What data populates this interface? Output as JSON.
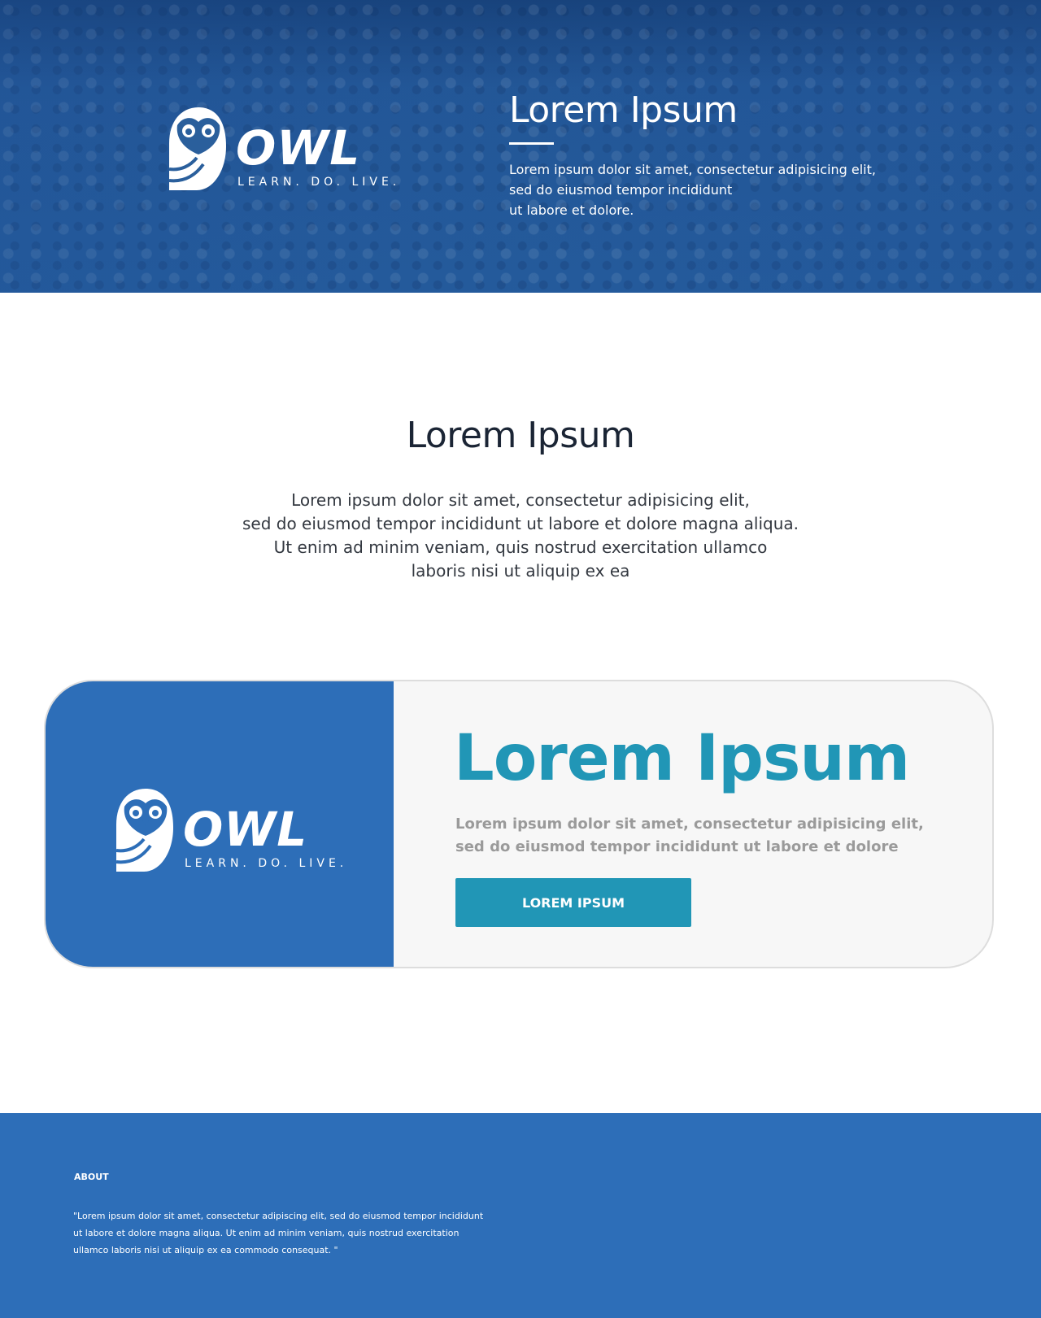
{
  "hero": {
    "logo": {
      "wordmark": "OWL",
      "tagline": "LEARN. DO. LIVE."
    },
    "title": "Lorem Ipsum",
    "lines": [
      "Lorem ipsum dolor sit amet, consectetur adipisicing elit,",
      "sed do eiusmod tempor incididunt",
      "ut labore et dolore."
    ]
  },
  "intro": {
    "title": "Lorem Ipsum",
    "lines": [
      "Lorem ipsum dolor sit amet, consectetur adipisicing elit,",
      "sed do eiusmod tempor incididunt ut labore et dolore magna aliqua.",
      "Ut enim ad minim veniam, quis nostrud exercitation ullamco",
      "laboris nisi ut aliquip ex ea"
    ]
  },
  "card": {
    "logo": {
      "wordmark": "OWL",
      "tagline": "LEARN. DO. LIVE."
    },
    "title": "Lorem Ipsum",
    "lines": [
      "Lorem ipsum dolor sit amet, consectetur adipisicing elit,",
      "sed do eiusmod tempor incididunt ut labore et dolore"
    ],
    "button_label": "LOREM IPSUM"
  },
  "footer": {
    "heading": "ABOUT",
    "lines": [
      "\"Lorem ipsum dolor sit amet, consectetur adipiscing elit, sed do eiusmod tempor incididunt",
      "ut labore et dolore magna aliqua. Ut enim ad minim veniam, quis nostrud exercitation",
      "ullamco laboris nisi ut aliquip ex ea commodo consequat. \""
    ]
  },
  "colors": {
    "brand_blue": "#2d6eb8",
    "accent_teal": "#2196b6",
    "card_bg": "#f7f7f7"
  },
  "icons": [
    "owl-logo-icon"
  ]
}
